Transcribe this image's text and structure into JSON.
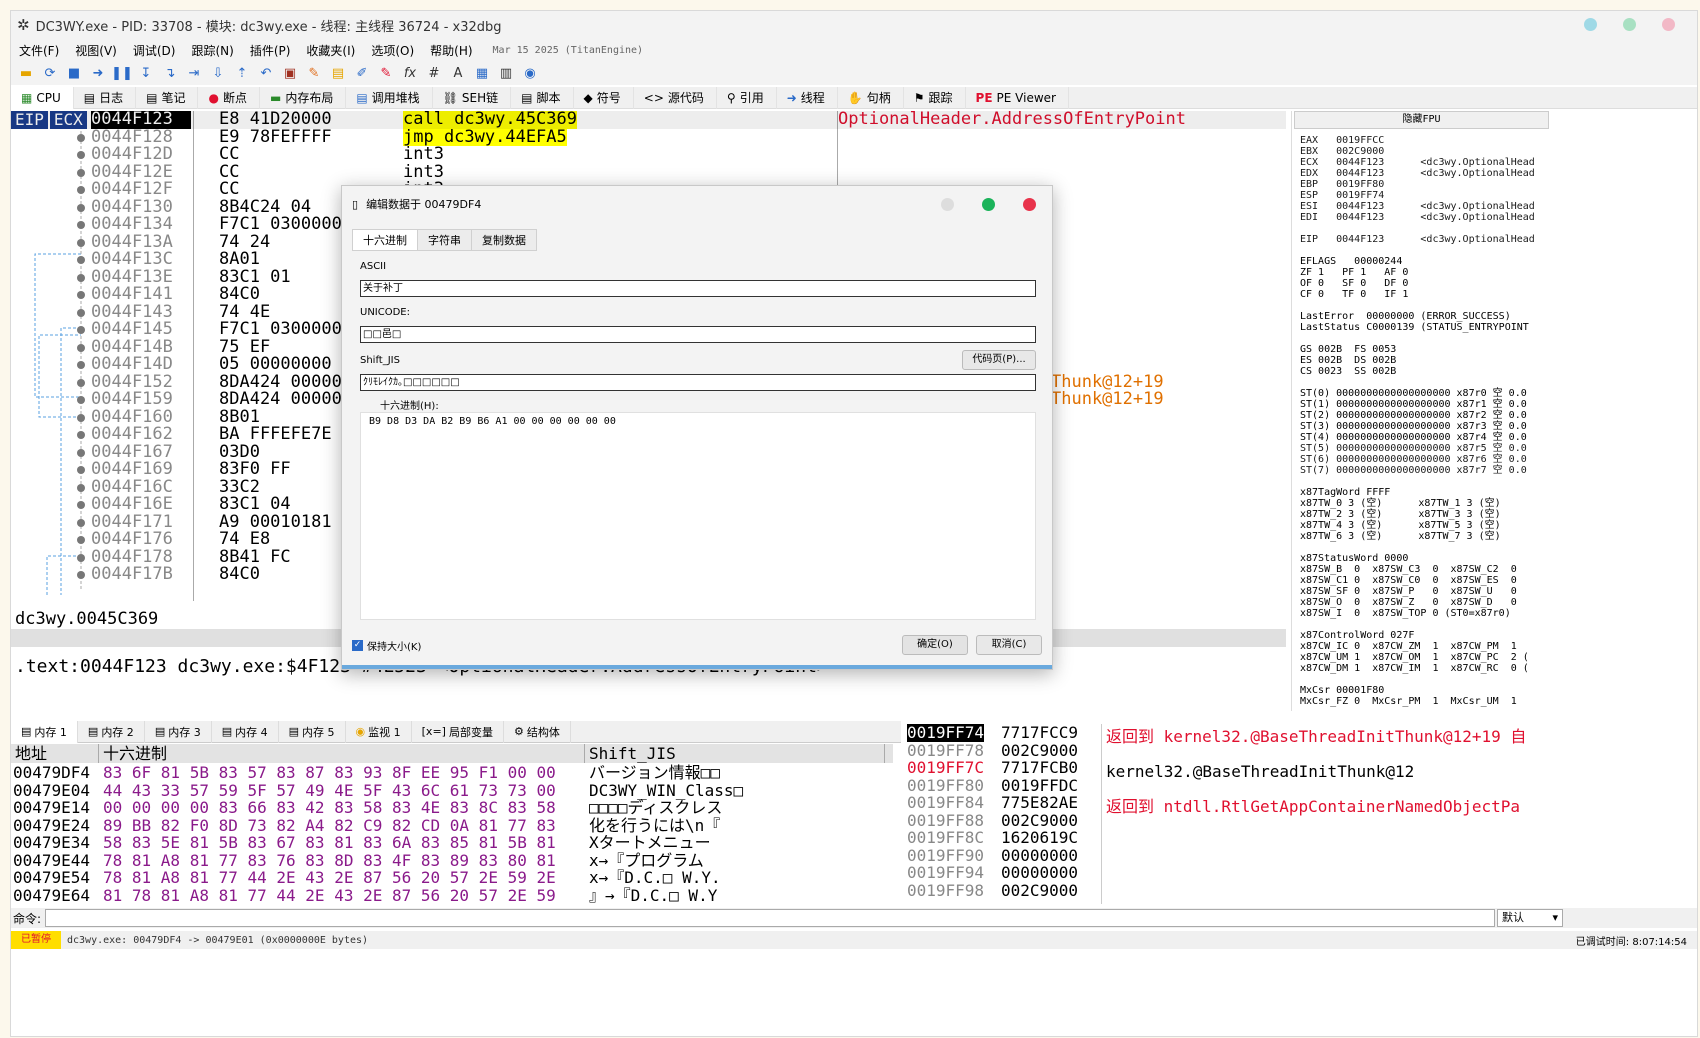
{
  "window": {
    "title": "DC3WY.exe - PID: 33708 - 模块: dc3wy.exe - 线程: 主线程 36724 - x32dbg"
  },
  "menu": {
    "items": [
      "文件(F)",
      "视图(V)",
      "调试(D)",
      "跟踪(N)",
      "插件(P)",
      "收藏夹(I)",
      "选项(O)",
      "帮助(H)"
    ],
    "date": "Mar 15 2025 (TitanEngine)"
  },
  "tabs": [
    "CPU",
    "日志",
    "笔记",
    "断点",
    "内存布局",
    "调用堆栈",
    "SEH链",
    "脚本",
    "符号",
    "源代码",
    "引用",
    "线程",
    "句柄",
    "跟踪",
    "PE Viewer"
  ],
  "disasm": {
    "regs_label": [
      "EIP",
      "ECX"
    ],
    "rows": [
      {
        "addr": "0044F123",
        "bytes": "E8 41D20000",
        "instr": "call dc3wy.45C369",
        "comment": "OptionalHeader.AddressOfEntryPoint"
      },
      {
        "addr": "0044F128",
        "bytes": "E9 78FEFFFF",
        "instr": "jmp dc3wy.44EFA5",
        "comment": ""
      },
      {
        "addr": "0044F12D",
        "bytes": "CC",
        "instr": "int3",
        "comment": ""
      },
      {
        "addr": "0044F12E",
        "bytes": "CC",
        "instr": "int3",
        "comment": ""
      },
      {
        "addr": "0044F12F",
        "bytes": "CC",
        "instr": "int3",
        "comment": ""
      },
      {
        "addr": "0044F130",
        "bytes": "8B4C24 04",
        "instr": "",
        "comment": ""
      },
      {
        "addr": "0044F134",
        "bytes": "F7C1 0300000",
        "instr": "",
        "comment": ""
      },
      {
        "addr": "0044F13A",
        "bytes": "74 24",
        "instr": "",
        "comment": ""
      },
      {
        "addr": "0044F13C",
        "bytes": "8A01",
        "instr": "",
        "comment": ""
      },
      {
        "addr": "0044F13E",
        "bytes": "83C1 01",
        "instr": "",
        "comment": ""
      },
      {
        "addr": "0044F141",
        "bytes": "84C0",
        "instr": "",
        "comment": ""
      },
      {
        "addr": "0044F143",
        "bytes": "74 4E",
        "instr": "",
        "comment": ""
      },
      {
        "addr": "0044F145",
        "bytes": "F7C1 0300000",
        "instr": "",
        "comment": ""
      },
      {
        "addr": "0044F14B",
        "bytes": "75 EF",
        "instr": "",
        "comment": ""
      },
      {
        "addr": "0044F14D",
        "bytes": "05 00000000",
        "instr": "",
        "comment": ""
      },
      {
        "addr": "0044F152",
        "bytes": "8DA424 00000",
        "instr": "",
        "comment": "Thunk@12+19"
      },
      {
        "addr": "0044F159",
        "bytes": "8DA424 00000",
        "instr": "",
        "comment": "Thunk@12+19"
      },
      {
        "addr": "0044F160",
        "bytes": "8B01",
        "instr": "",
        "comment": ""
      },
      {
        "addr": "0044F162",
        "bytes": "BA FFFEFE7E",
        "instr": "",
        "comment": ""
      },
      {
        "addr": "0044F167",
        "bytes": "03D0",
        "instr": "",
        "comment": ""
      },
      {
        "addr": "0044F169",
        "bytes": "83F0 FF",
        "instr": "",
        "comment": ""
      },
      {
        "addr": "0044F16C",
        "bytes": "33C2",
        "instr": "",
        "comment": ""
      },
      {
        "addr": "0044F16E",
        "bytes": "83C1 04",
        "instr": "",
        "comment": ""
      },
      {
        "addr": "0044F171",
        "bytes": "A9 00010181",
        "instr": "",
        "comment": ""
      },
      {
        "addr": "0044F176",
        "bytes": "74 E8",
        "instr": "",
        "comment": ""
      },
      {
        "addr": "0044F178",
        "bytes": "8B41 FC",
        "instr": "",
        "comment": ""
      },
      {
        "addr": "0044F17B",
        "bytes": "84C0",
        "instr": "",
        "comment": ""
      }
    ],
    "info": "dc3wy.0045C369",
    "section": ".text:0044F123 dc3wy.exe:$4F123 #4E523 <OptionalHeader.AddressOfEntryPoint>"
  },
  "registers": {
    "header": "隐藏FPU",
    "lines": [
      {
        "t": "EAX   0019FFCC",
        "r": 1
      },
      {
        "t": "EBX   002C9000",
        "r": 1
      },
      {
        "t": "ECX   0044F123      <dc3wy.OptionalHead",
        "r": 1
      },
      {
        "t": "EDX   0044F123      <dc3wy.OptionalHead",
        "r": 1
      },
      {
        "t": "EBP   0019FF80",
        "r": 1
      },
      {
        "t": "ESP   0019FF74",
        "r": 1
      },
      {
        "t": "ESI   0044F123      <dc3wy.OptionalHead",
        "r": 1
      },
      {
        "t": "EDI   0044F123      <dc3wy.OptionalHead",
        "r": 1
      },
      {
        "t": "",
        "r": 0
      },
      {
        "t": "EIP   0044F123      <dc3wy.OptionalHead",
        "r": 1
      },
      {
        "t": "",
        "r": 0
      },
      {
        "t": "EFLAGS   00000244",
        "r": 0
      },
      {
        "t": "ZF 1   PF 1   AF 0",
        "r": 0
      },
      {
        "t": "OF 0   SF 0   DF 0",
        "r": 0
      },
      {
        "t": "CF 0   TF 0   IF 1",
        "r": 0
      },
      {
        "t": "",
        "r": 0
      },
      {
        "t": "LastError  00000000 (ERROR_SUCCESS)",
        "r": 0
      },
      {
        "t": "LastStatus C0000139 (STATUS_ENTRYPOINT",
        "r": 0
      },
      {
        "t": "",
        "r": 0
      },
      {
        "t": "GS 002B  FS 0053",
        "r": 0
      },
      {
        "t": "ES 002B  DS 002B",
        "r": 0
      },
      {
        "t": "CS 0023  SS 002B",
        "r": 0
      },
      {
        "t": "",
        "r": 0
      },
      {
        "t": "ST(0) 0000000000000000000 x87r0 空 0.0",
        "r": 0
      },
      {
        "t": "ST(1) 0000000000000000000 x87r1 空 0.0",
        "r": 0
      },
      {
        "t": "ST(2) 0000000000000000000 x87r2 空 0.0",
        "r": 0
      },
      {
        "t": "ST(3) 0000000000000000000 x87r3 空 0.0",
        "r": 0
      },
      {
        "t": "ST(4) 0000000000000000000 x87r4 空 0.0",
        "r": 0
      },
      {
        "t": "ST(5) 0000000000000000000 x87r5 空 0.0",
        "r": 1
      },
      {
        "t": "ST(6) 0000000000000000000 x87r6 空 0.0",
        "r": 1
      },
      {
        "t": "ST(7) 0000000000000000000 x87r7 空 0.0",
        "r": 1
      },
      {
        "t": "",
        "r": 0
      },
      {
        "t": "x87TagWord FFFF",
        "r": 0
      },
      {
        "t": "x87TW_0 3 (空)      x87TW_1 3 (空)",
        "r": 0
      },
      {
        "t": "x87TW_2 3 (空)      x87TW_3 3 (空)",
        "r": 0
      },
      {
        "t": "x87TW_4 3 (空)      x87TW_5 3 (空)",
        "r": 0
      },
      {
        "t": "x87TW_6 3 (空)      x87TW_7 3 (空)",
        "r": 0
      },
      {
        "t": "",
        "r": 0
      },
      {
        "t": "x87StatusWord 0000",
        "r": 0
      },
      {
        "t": "x87SW_B  0  x87SW_C3  0  x87SW_C2  0",
        "r": 0
      },
      {
        "t": "x87SW_C1 0  x87SW_C0  0  x87SW_ES  0",
        "r": 0
      },
      {
        "t": "x87SW_SF 0  x87SW_P   0  x87SW_U   0",
        "r": 0
      },
      {
        "t": "x87SW_O  0  x87SW_Z   0  x87SW_D   0",
        "r": 0
      },
      {
        "t": "x87SW_I  0  x87SW_TOP 0 (ST0=x87r0)",
        "r": 0
      },
      {
        "t": "",
        "r": 0
      },
      {
        "t": "x87ControlWord 027F",
        "r": 0
      },
      {
        "t": "x87CW_IC 0  x87CW_ZM  1  x87CW_PM  1",
        "r": 0
      },
      {
        "t": "x87CW_UM 1  x87CW_OM  1  x87CW_PC  2 (",
        "r": 0
      },
      {
        "t": "x87CW_DM 1  x87CW_IM  1  x87CW_RC  0 (",
        "r": 0
      },
      {
        "t": "",
        "r": 0
      },
      {
        "t": "MxCsr 00001F80",
        "r": 0
      },
      {
        "t": "MxCsr_FZ 0  MxCsr_PM  1  MxCsr_UM  1",
        "r": 0
      }
    ]
  },
  "bottom_tabs": [
    "内存 1",
    "内存 2",
    "内存 3",
    "内存 4",
    "内存 5",
    "监视 1",
    "局部变量",
    "结构体"
  ],
  "dump": {
    "headers": [
      "地址",
      "十六进制",
      "Shift_JIS"
    ],
    "rows": [
      {
        "a": "00479DF4",
        "h": "83 6F 81 5B 83 57 83 87 83 93 8F EE 95 F1 00 00",
        "t": "バージョン情報□□"
      },
      {
        "a": "00479E04",
        "h": "44 43 33 57 59 5F 57 49 4E 5F 43 6C 61 73 73 00",
        "t": "DC3WY_WIN_Class□"
      },
      {
        "a": "00479E14",
        "h": "00 00 00 00 83 66 83 42 83 58 83 4E 83 8C 83 58",
        "t": "□□□□ディスクレス"
      },
      {
        "a": "00479E24",
        "h": "89 BB 82 F0 8D 73 82 A4 82 C9 82 CD 0A 81 77 83",
        "t": "化を行うには\\n『"
      },
      {
        "a": "00479E34",
        "h": "58 83 5E 81 5B 83 67 83 81 83 6A 83 85 81 5B 81",
        "t": "Xタートメニュー"
      },
      {
        "a": "00479E44",
        "h": "78 81 A8 81 77 83 76 83 8D 83 4F 83 89 83 80 81",
        "t": "x→『プログラム"
      },
      {
        "a": "00479E54",
        "h": "78 81 A8 81 77 44 2E 43 2E 87 56 20 57 2E 59 2E",
        "t": "x→『D.C.□ W.Y."
      },
      {
        "a": "00479E64",
        "h": "81 78 81 A8 81 77 44 2E 43 2E 87 56 20 57 2E 59",
        "t": "』→『D.C.□ W.Y"
      }
    ]
  },
  "stack": {
    "rows": [
      {
        "a": "0019FF74",
        "v": "7717FCC9",
        "c": "返回到 kernel32.@BaseThreadInitThunk@12+19 自"
      },
      {
        "a": "0019FF78",
        "v": "002C9000",
        "c": ""
      },
      {
        "a": "0019FF7C",
        "v": "7717FCB0",
        "c": "kernel32.@BaseThreadInitThunk@12"
      },
      {
        "a": "0019FF80",
        "v": "0019FFDC",
        "c": ""
      },
      {
        "a": "0019FF84",
        "v": "775E82AE",
        "c": "返回到 ntdll.RtlGetAppContainerNamedObjectPa"
      },
      {
        "a": "0019FF88",
        "v": "002C9000",
        "c": ""
      },
      {
        "a": "0019FF8C",
        "v": "1620619C",
        "c": ""
      },
      {
        "a": "0019FF90",
        "v": "00000000",
        "c": ""
      },
      {
        "a": "0019FF94",
        "v": "00000000",
        "c": ""
      },
      {
        "a": "0019FF98",
        "v": "002C9000",
        "c": ""
      }
    ]
  },
  "command": {
    "label": "命令:",
    "mode": "默认"
  },
  "status": {
    "paused": "已暂停",
    "text": "dc3wy.exe: 00479DF4 -> 00479E01 (0x0000000E bytes)",
    "time": "已调试时间:  8:07:14:54"
  },
  "dialog": {
    "title": "编辑数据于  00479DF4",
    "tabs": [
      "十六进制",
      "字符串",
      "复制数据"
    ],
    "ascii_label": "ASCII",
    "ascii_value": "关于补丁",
    "unicode_label": "UNICODE:",
    "unicode_value": "□□邑□",
    "sjis_label": "Shift_JIS",
    "sjis_value": "ｸﾘﾓﾚｲｸｶ｡□□□□□□",
    "codepage_btn": "代码页(P)...",
    "hex_label": "十六进制(H):",
    "hex_value": "B9 D8 D3 DA B2 B9 B6 A1 00 00 00 00 00 00",
    "keep_size": "保持大小(K)",
    "ok": "确定(O)",
    "cancel": "取消(C)"
  }
}
